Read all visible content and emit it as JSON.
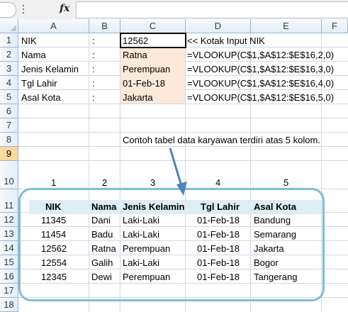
{
  "formula_bar": {
    "fx_label": "fx",
    "content": ""
  },
  "columns": [
    "A",
    "B",
    "C",
    "D",
    "E",
    "F"
  ],
  "rows": [
    "1",
    "2",
    "3",
    "4",
    "5",
    "6",
    "7",
    "8",
    "9",
    "10",
    "11",
    "12",
    "13",
    "14",
    "15",
    "16",
    "17",
    "18"
  ],
  "selected_row": "9",
  "lookup_panel": {
    "labels": [
      "NIK",
      "Nama",
      "Jenis Kelamin",
      "Tgl Lahir",
      "Asal Kota"
    ],
    "colon": ":",
    "input_value": "12562",
    "input_note": "<< Kotak Input NIK",
    "results": [
      "Ratna",
      "Perempuan",
      "01-Feb-18",
      "Jakarta"
    ],
    "formulas": [
      "=VLOOKUP(C$1,$A$12:$E$16,2,0)",
      "=VLOOKUP(C$1,$A$12:$E$16,3,0)",
      "=VLOOKUP(C$1,$A$12:$E$16,4,0)",
      "=VLOOKUP(C$1,$A$12:$E$16,5,0)"
    ]
  },
  "annotation": "Contoh tabel data karyawan terdiri atas 5 kolom.",
  "column_numbers": [
    "1",
    "2",
    "3",
    "4",
    "5"
  ],
  "table": {
    "headers": [
      "NIK",
      "Nama",
      "Jenis Kelamin",
      "Tgl Lahir",
      "Asal Kota"
    ],
    "rows": [
      [
        "11345",
        "Dani",
        "Laki-Laki",
        "01-Feb-18",
        "Bandung"
      ],
      [
        "11454",
        "Badu",
        "Laki-Laki",
        "01-Feb-18",
        "Semarang"
      ],
      [
        "12562",
        "Ratna",
        "Perempuan",
        "01-Feb-18",
        "Jakarta"
      ],
      [
        "12554",
        "Galih",
        "Laki-Laki",
        "01-Feb-18",
        "Bogor"
      ],
      [
        "12345",
        "Dewi",
        "Perempuan",
        "01-Feb-18",
        "Tangerang"
      ]
    ]
  },
  "colors": {
    "input_fill": "#fde9d9",
    "table_border": "#7cbfd0",
    "table_header_fill": "#daeef3",
    "arrow": "#4f81bd",
    "selected_row_header": "#f9d99f"
  }
}
